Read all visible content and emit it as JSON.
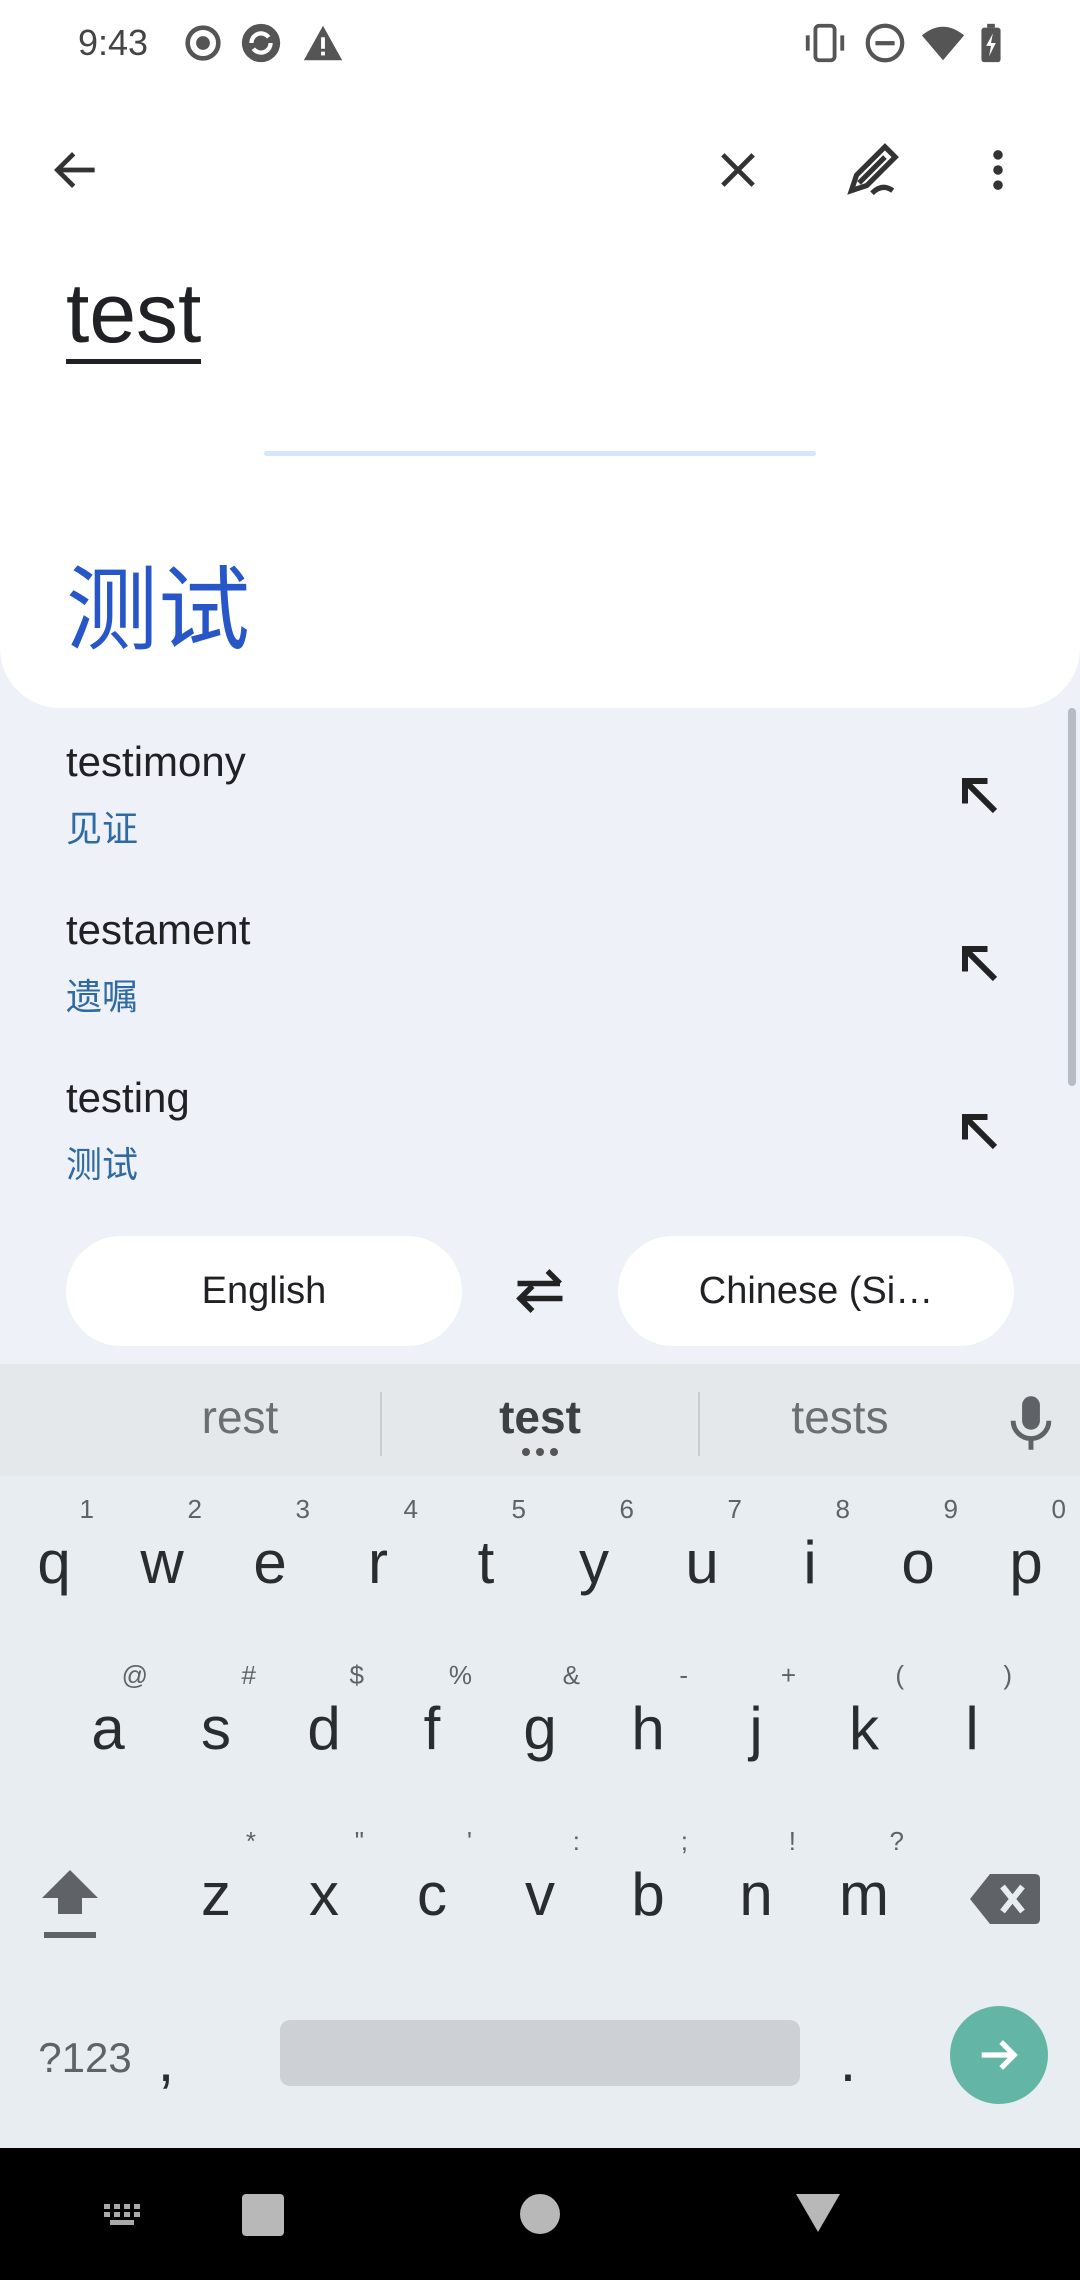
{
  "status_bar": {
    "time": "9:43",
    "left_icons": [
      "record-icon",
      "sync-icon",
      "warning-icon"
    ],
    "right_icons": [
      "vibrate-icon",
      "dnd-icon",
      "wifi-icon",
      "battery-icon"
    ]
  },
  "toolbar": {
    "back": "back-arrow-icon",
    "clear": "close-icon",
    "handwriting": "handwriting-icon",
    "more": "more-vert-icon"
  },
  "translation": {
    "source": "test",
    "target": "测试"
  },
  "suggestions": [
    {
      "word": "testimony",
      "translation": "见证"
    },
    {
      "word": "testament",
      "translation": "遗嘱"
    },
    {
      "word": "testing",
      "translation": "测试"
    }
  ],
  "languages": {
    "source": "English",
    "target": "Chinese (Si…"
  },
  "keyboard": {
    "suggestions": [
      "rest",
      "test",
      "tests"
    ],
    "rows": [
      [
        {
          "k": "q",
          "h": "1"
        },
        {
          "k": "w",
          "h": "2"
        },
        {
          "k": "e",
          "h": "3"
        },
        {
          "k": "r",
          "h": "4"
        },
        {
          "k": "t",
          "h": "5"
        },
        {
          "k": "y",
          "h": "6"
        },
        {
          "k": "u",
          "h": "7"
        },
        {
          "k": "i",
          "h": "8"
        },
        {
          "k": "o",
          "h": "9"
        },
        {
          "k": "p",
          "h": "0"
        }
      ],
      [
        {
          "k": "a",
          "h": "@"
        },
        {
          "k": "s",
          "h": "#"
        },
        {
          "k": "d",
          "h": "$"
        },
        {
          "k": "f",
          "h": "%"
        },
        {
          "k": "g",
          "h": "&"
        },
        {
          "k": "h",
          "h": "-"
        },
        {
          "k": "j",
          "h": "+"
        },
        {
          "k": "k",
          "h": "("
        },
        {
          "k": "l",
          "h": ")"
        }
      ],
      [
        {
          "k": "z",
          "h": "*"
        },
        {
          "k": "x",
          "h": "\""
        },
        {
          "k": "c",
          "h": "'"
        },
        {
          "k": "v",
          "h": ":"
        },
        {
          "k": "b",
          "h": ";"
        },
        {
          "k": "n",
          "h": "!"
        },
        {
          "k": "m",
          "h": "?"
        }
      ]
    ],
    "symbols_label": "?123",
    "comma": ",",
    "period": "."
  }
}
